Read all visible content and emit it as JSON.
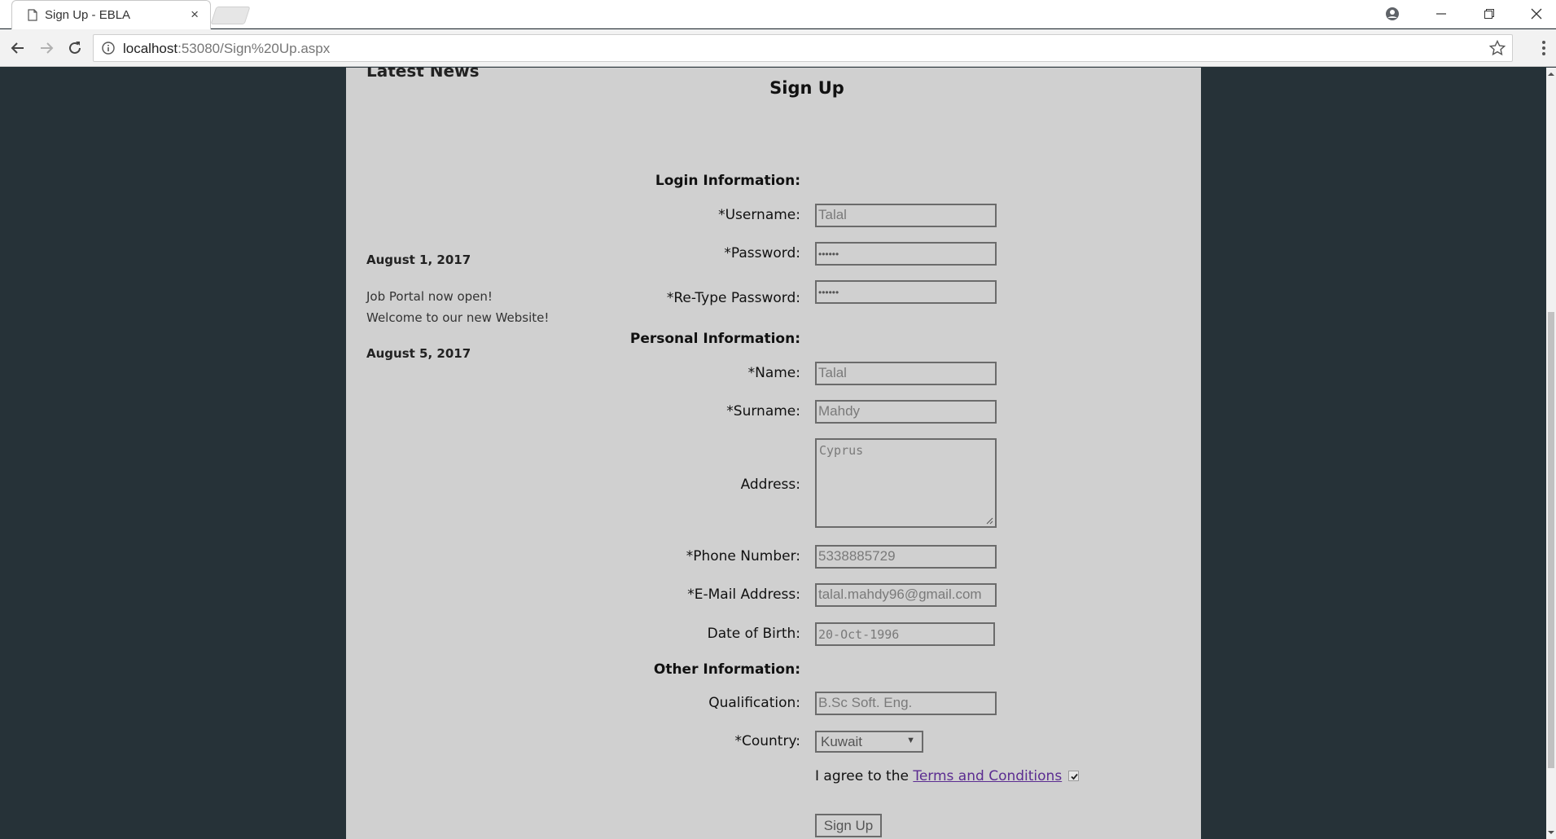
{
  "browser": {
    "tab_title": "Sign Up - EBLA",
    "tab_close": "×",
    "url_host": "localhost",
    "url_rest": ":53080/Sign%20Up.aspx"
  },
  "news": {
    "heading": "Latest News",
    "items": [
      {
        "date": "August 1, 2017",
        "lines": [
          "Job Portal now open!",
          "Welcome to our new Website!"
        ]
      },
      {
        "date": "August 5, 2017"
      }
    ]
  },
  "form": {
    "title": "Sign Up",
    "sections": {
      "login": "Login Information:",
      "personal": "Personal Information:",
      "other": "Other Information:"
    },
    "labels": {
      "username": "*Username:",
      "password": "*Password:",
      "retype_password": "*Re-Type Password:",
      "name": "*Name:",
      "surname": "*Surname:",
      "address": "Address:",
      "phone": "*Phone Number:",
      "email": "*E-Mail Address:",
      "dob": "Date of Birth:",
      "qualification": "Qualification:",
      "country": "*Country:"
    },
    "values": {
      "username": "Talal",
      "password": "••••••",
      "retype_password": "••••••",
      "name": "Talal",
      "surname": "Mahdy",
      "address": "Cyprus",
      "phone": "5338885729",
      "email": "talal.mahdy96@gmail.com",
      "dob": "20-Oct-1996",
      "qualification": "B.Sc Soft. Eng.",
      "country": "Kuwait"
    },
    "agree_prefix": "I agree to the ",
    "terms_link": "Terms and Conditions",
    "terms_checked": true,
    "submit_label": "Sign Up"
  }
}
